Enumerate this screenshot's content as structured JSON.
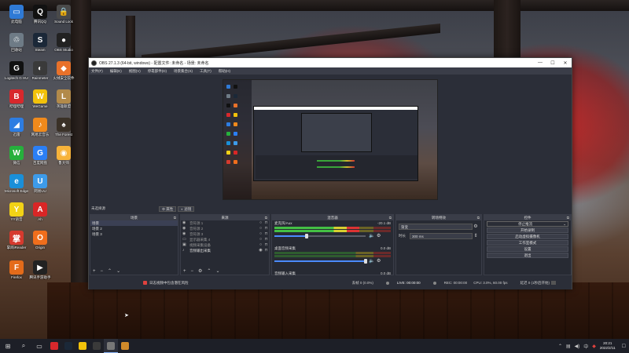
{
  "desktop": {
    "icons": [
      {
        "label": "此电脑",
        "glyph": "▭",
        "color": "#2f7ad6"
      },
      {
        "label": "腾讯QQ",
        "glyph": "Q",
        "color": "#111111"
      },
      {
        "label": "Sound Lock",
        "glyph": "🔒",
        "color": "#4a4a4a"
      },
      {
        "label": "回收站",
        "glyph": "♲",
        "color": "#6e7b86"
      },
      {
        "label": "Steam",
        "glyph": "S",
        "color": "#1b2838"
      },
      {
        "label": "OBS Studio",
        "glyph": "●",
        "color": "#222222"
      },
      {
        "label": "Logitech G HUB",
        "glyph": "G",
        "color": "#111111"
      },
      {
        "label": "Rainmeter",
        "glyph": "◐",
        "color": "#3a3a3a"
      },
      {
        "label": "火绒安全软件",
        "glyph": "◆",
        "color": "#e8712a"
      },
      {
        "label": "哔哩哔哩",
        "glyph": "B",
        "color": "#d8282c"
      },
      {
        "label": "WeGame",
        "glyph": "W",
        "color": "#f2c20a"
      },
      {
        "label": "英雄联盟",
        "glyph": "L",
        "color": "#b28a4a"
      },
      {
        "label": "迅雷",
        "glyph": "◢",
        "color": "#2d7de2"
      },
      {
        "label": "网易云音乐",
        "glyph": "♪",
        "color": "#f08a1c"
      },
      {
        "label": "The Forest",
        "glyph": "♠",
        "color": "#3a3127"
      },
      {
        "label": "微信",
        "glyph": "W",
        "color": "#26b03c"
      },
      {
        "label": "百度网盘",
        "glyph": "G",
        "color": "#2b7ff5"
      },
      {
        "label": "鲁大师",
        "glyph": "◉",
        "color": "#f7b33a"
      },
      {
        "label": "Microsoft Edge",
        "glyph": "e",
        "color": "#1a8fd8"
      },
      {
        "label": "网易UU",
        "glyph": "U",
        "color": "#3d9be9"
      },
      {
        "label": "YY语音",
        "glyph": "Y",
        "color": "#f2d216"
      },
      {
        "label": "Ah",
        "glyph": "A",
        "color": "#d92626"
      },
      {
        "label": "掌阅iReader",
        "glyph": "掌",
        "color": "#d63a2e"
      },
      {
        "label": "Origin",
        "glyph": "O",
        "color": "#f06e1c"
      },
      {
        "label": "Firefox",
        "glyph": "F",
        "color": "#e46b1a"
      },
      {
        "label": "腾讯手游助手",
        "glyph": "▶",
        "color": "#222222"
      }
    ]
  },
  "obs": {
    "window_title": "OBS 27.1.3 (64-bit, windows) - 配置文件: 未命名 - 场景: 未命名",
    "window_controls": {
      "minimize": "—",
      "maximize": "☐",
      "close": "✕"
    },
    "menu": [
      "文件(F)",
      "编辑(E)",
      "视图(V)",
      "停靠部件(D)",
      "场景集合(S)",
      "工具(T)",
      "帮助(H)"
    ],
    "current_scene_label": "未选择源",
    "properties_button": "属性",
    "filters_button": "滤镜",
    "docks": {
      "scenes": {
        "title": "场景",
        "items": [
          {
            "label": "场景",
            "selected": true
          },
          {
            "label": "场景 2",
            "selected": false
          },
          {
            "label": "场景 3",
            "selected": false
          }
        ]
      },
      "sources": {
        "title": "来源",
        "items": [
          {
            "icon": "◉",
            "label": "音符源 1",
            "visible": false
          },
          {
            "icon": "◉",
            "label": "音符源 2",
            "visible": false
          },
          {
            "icon": "◉",
            "label": "音符源 3",
            "visible": false
          },
          {
            "icon": "▭",
            "label": "显示器采集 4",
            "visible": false
          },
          {
            "icon": "▣",
            "label": "视频采集设备",
            "visible": false
          },
          {
            "icon": "♪",
            "label": "音频输出采集",
            "visible": true
          }
        ]
      },
      "mixer": {
        "title": "混音器",
        "channels": [
          {
            "name": "麦克风/Aux",
            "db": "-20.1 dB",
            "level": 0.73,
            "volume": 0.35
          },
          {
            "name": "桌面音频采集",
            "db": "0.0 dB",
            "level": 0.0,
            "volume": 1.0
          },
          {
            "name": "音频输入采集",
            "db": "0.0 dB",
            "level": 0.0,
            "volume": 1.0
          }
        ]
      },
      "transitions": {
        "title": "转场特效",
        "type": "渐变",
        "duration_label": "时长",
        "duration": "300 ms"
      },
      "controls": {
        "title": "控件",
        "buttons": [
          "停止推流",
          "开始录制",
          "启动虚拟摄像机",
          "工作室模式",
          "设置",
          "退出"
        ]
      }
    },
    "status": {
      "dropped": "丢帧 0 (0.0%)",
      "live": "LIVE: 00:00:00",
      "rec": "REC: 00:00:00",
      "cpu": "CPU: 3.0%, 60.00 fps",
      "kbps": "延迟 0 (1秒后开始)"
    },
    "notification": "日志视频中包含潜在风险"
  },
  "taskbar": {
    "apps": [
      {
        "name": "哔哩哔哩",
        "color": "#d8282c",
        "active": false
      },
      {
        "name": "Steam",
        "color": "#1b2838",
        "active": false
      },
      {
        "name": "腾讯",
        "color": "#f2c20a",
        "active": false
      },
      {
        "name": "Rainmeter",
        "color": "#3a3a3a",
        "active": false
      },
      {
        "name": "OBS",
        "color": "#777777",
        "active": true
      },
      {
        "name": "英雄联盟",
        "color": "#d08a2a",
        "active": false
      }
    ],
    "time": "20:21",
    "date": "2022/2/11"
  }
}
